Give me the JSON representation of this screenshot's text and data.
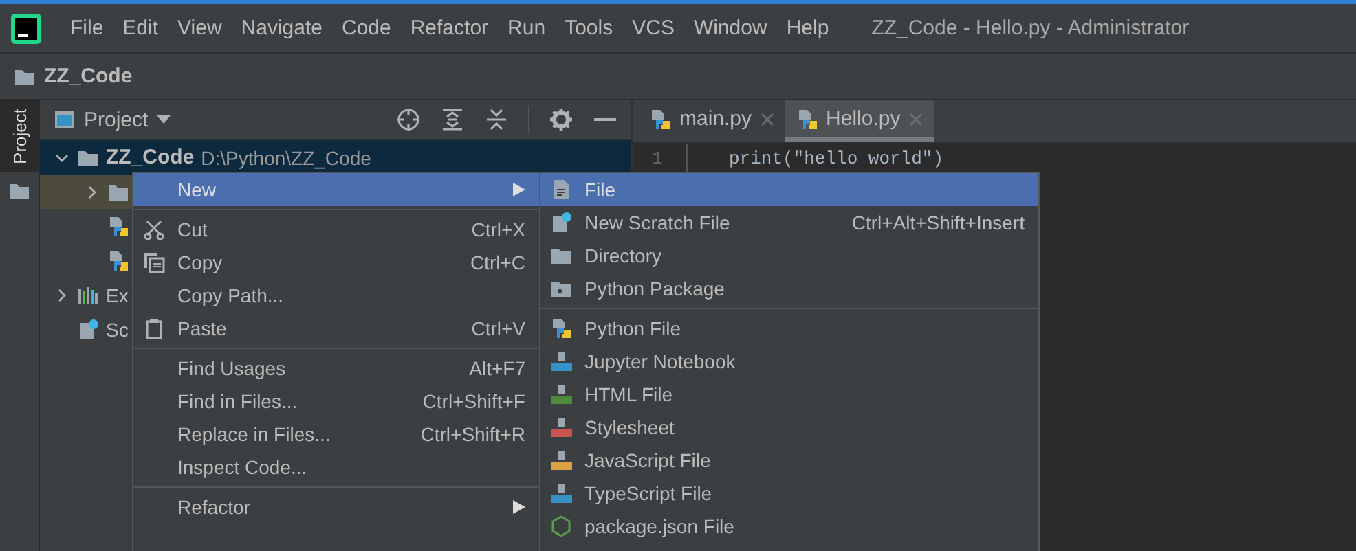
{
  "menubar": {
    "items": [
      "File",
      "Edit",
      "View",
      "Navigate",
      "Code",
      "Refactor",
      "Run",
      "Tools",
      "VCS",
      "Window",
      "Help"
    ],
    "title": "ZZ_Code - Hello.py - Administrator"
  },
  "navbar": {
    "crumb": "ZZ_Code"
  },
  "side_strip": {
    "tabs": [
      {
        "label": "Project",
        "selected": true
      }
    ]
  },
  "project_panel": {
    "title": "Project"
  },
  "tree": [
    {
      "label": "ZZ_Code",
      "hint": "D:\\Python\\ZZ_Code",
      "kind": "folder",
      "expanded": true,
      "selected": true,
      "highlighted": false,
      "children": [
        {
          "kind": "folder",
          "expanded": false,
          "selected": false,
          "highlighted": true
        },
        {
          "kind": "python",
          "selected": false,
          "highlighted": false
        },
        {
          "kind": "python",
          "selected": false,
          "highlighted": false
        }
      ]
    },
    {
      "label": "Ex",
      "kind": "library",
      "expanded": false,
      "selected": false,
      "highlighted": false
    },
    {
      "label": "Sc",
      "kind": "scratch",
      "selected": false,
      "highlighted": false
    }
  ],
  "editor": {
    "tabs": [
      {
        "label": "main.py",
        "selected": false
      },
      {
        "label": "Hello.py",
        "selected": true
      }
    ],
    "line_number": "1",
    "code": "print(\"hello world\")"
  },
  "context_menu": {
    "items": [
      {
        "kind": "plain",
        "label": "New",
        "selected": true,
        "submenu": true
      },
      {
        "kind": "separator"
      },
      {
        "kind": "cut",
        "label": "Cut",
        "shortcut": "Ctrl+X",
        "selected": false
      },
      {
        "kind": "copy",
        "label": "Copy",
        "shortcut": "Ctrl+C",
        "selected": false
      },
      {
        "kind": "plain",
        "label": "Copy Path...",
        "selected": false
      },
      {
        "kind": "paste",
        "label": "Paste",
        "shortcut": "Ctrl+V",
        "selected": false
      },
      {
        "kind": "separator"
      },
      {
        "kind": "plain",
        "label": "Find Usages",
        "shortcut": "Alt+F7",
        "selected": false
      },
      {
        "kind": "plain",
        "label": "Find in Files...",
        "shortcut": "Ctrl+Shift+F",
        "selected": false
      },
      {
        "kind": "plain",
        "label": "Replace in Files...",
        "shortcut": "Ctrl+Shift+R",
        "selected": false
      },
      {
        "kind": "plain",
        "label": "Inspect Code...",
        "selected": false
      },
      {
        "kind": "separator"
      },
      {
        "kind": "plain",
        "label": "Refactor",
        "selected": false,
        "submenu": true
      }
    ]
  },
  "submenu": {
    "items": [
      {
        "kind": "file",
        "label": "File",
        "selected": true
      },
      {
        "kind": "scratch",
        "label": "New Scratch File",
        "shortcut": "Ctrl+Alt+Shift+Insert",
        "selected": false
      },
      {
        "kind": "folder",
        "label": "Directory",
        "selected": false
      },
      {
        "kind": "package",
        "label": "Python Package",
        "selected": false
      },
      {
        "kind": "separator"
      },
      {
        "kind": "python",
        "label": "Python File",
        "selected": false
      },
      {
        "kind": "jupyter",
        "label": "Jupyter Notebook",
        "selected": false
      },
      {
        "kind": "html",
        "label": "HTML File",
        "selected": false
      },
      {
        "kind": "css",
        "label": "Stylesheet",
        "selected": false
      },
      {
        "kind": "js",
        "label": "JavaScript File",
        "selected": false
      },
      {
        "kind": "ts",
        "label": "TypeScript File",
        "selected": false
      },
      {
        "kind": "nodejs",
        "label": "package.json File",
        "selected": false
      }
    ]
  }
}
